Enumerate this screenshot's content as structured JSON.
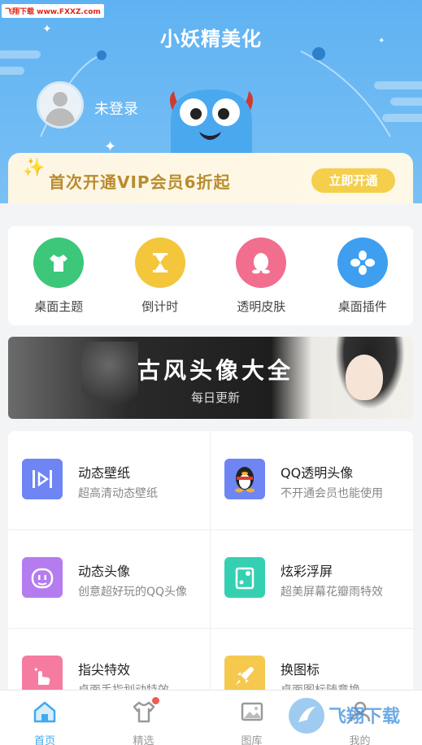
{
  "watermark": "飞翔下载 www.FXXZ.com",
  "header": {
    "title": "小妖精美化",
    "login_text": "未登录"
  },
  "vip": {
    "text": "首次开通VIP会员6折起",
    "button": "立即开通"
  },
  "shortcuts": [
    {
      "label": "桌面主题",
      "icon": "shirt-icon",
      "color": "#3cc77a"
    },
    {
      "label": "倒计时",
      "icon": "hourglass-icon",
      "color": "#f3c63c"
    },
    {
      "label": "透明皮肤",
      "icon": "qq-penguin-icon",
      "color": "#f16e8e"
    },
    {
      "label": "桌面插件",
      "icon": "clover-icon",
      "color": "#3e9ff0"
    }
  ],
  "promo": {
    "title": "古风头像大全",
    "subtitle": "每日更新"
  },
  "features": [
    {
      "title": "动态壁纸",
      "subtitle": "超高清动态壁纸",
      "icon": "play-icon",
      "color": "#6e85f3"
    },
    {
      "title": "QQ透明头像",
      "subtitle": "不开通会员也能使用",
      "icon": "penguin-icon",
      "color": "#6e85f3"
    },
    {
      "title": "动态头像",
      "subtitle": "创意超好玩的QQ头像",
      "icon": "face-icon",
      "color": "#b57cf0"
    },
    {
      "title": "炫彩浮屏",
      "subtitle": "超美屏幕花瓣雨特效",
      "icon": "float-screen-icon",
      "color": "#35d0b2"
    },
    {
      "title": "指尖特效",
      "subtitle": "桌面手指划动特效",
      "icon": "finger-icon",
      "color": "#f57ca0"
    },
    {
      "title": "换图标",
      "subtitle": "桌面图标随意换",
      "icon": "rocket-icon",
      "color": "#f5c94e"
    }
  ],
  "tabs": [
    {
      "label": "首页",
      "icon": "home-icon",
      "active": true
    },
    {
      "label": "精选",
      "icon": "shirt-icon",
      "active": false,
      "badge": true
    },
    {
      "label": "图库",
      "icon": "image-icon",
      "active": false
    },
    {
      "label": "我的",
      "icon": "user-icon",
      "active": false
    }
  ],
  "bottom_watermark": "飞翔下载"
}
